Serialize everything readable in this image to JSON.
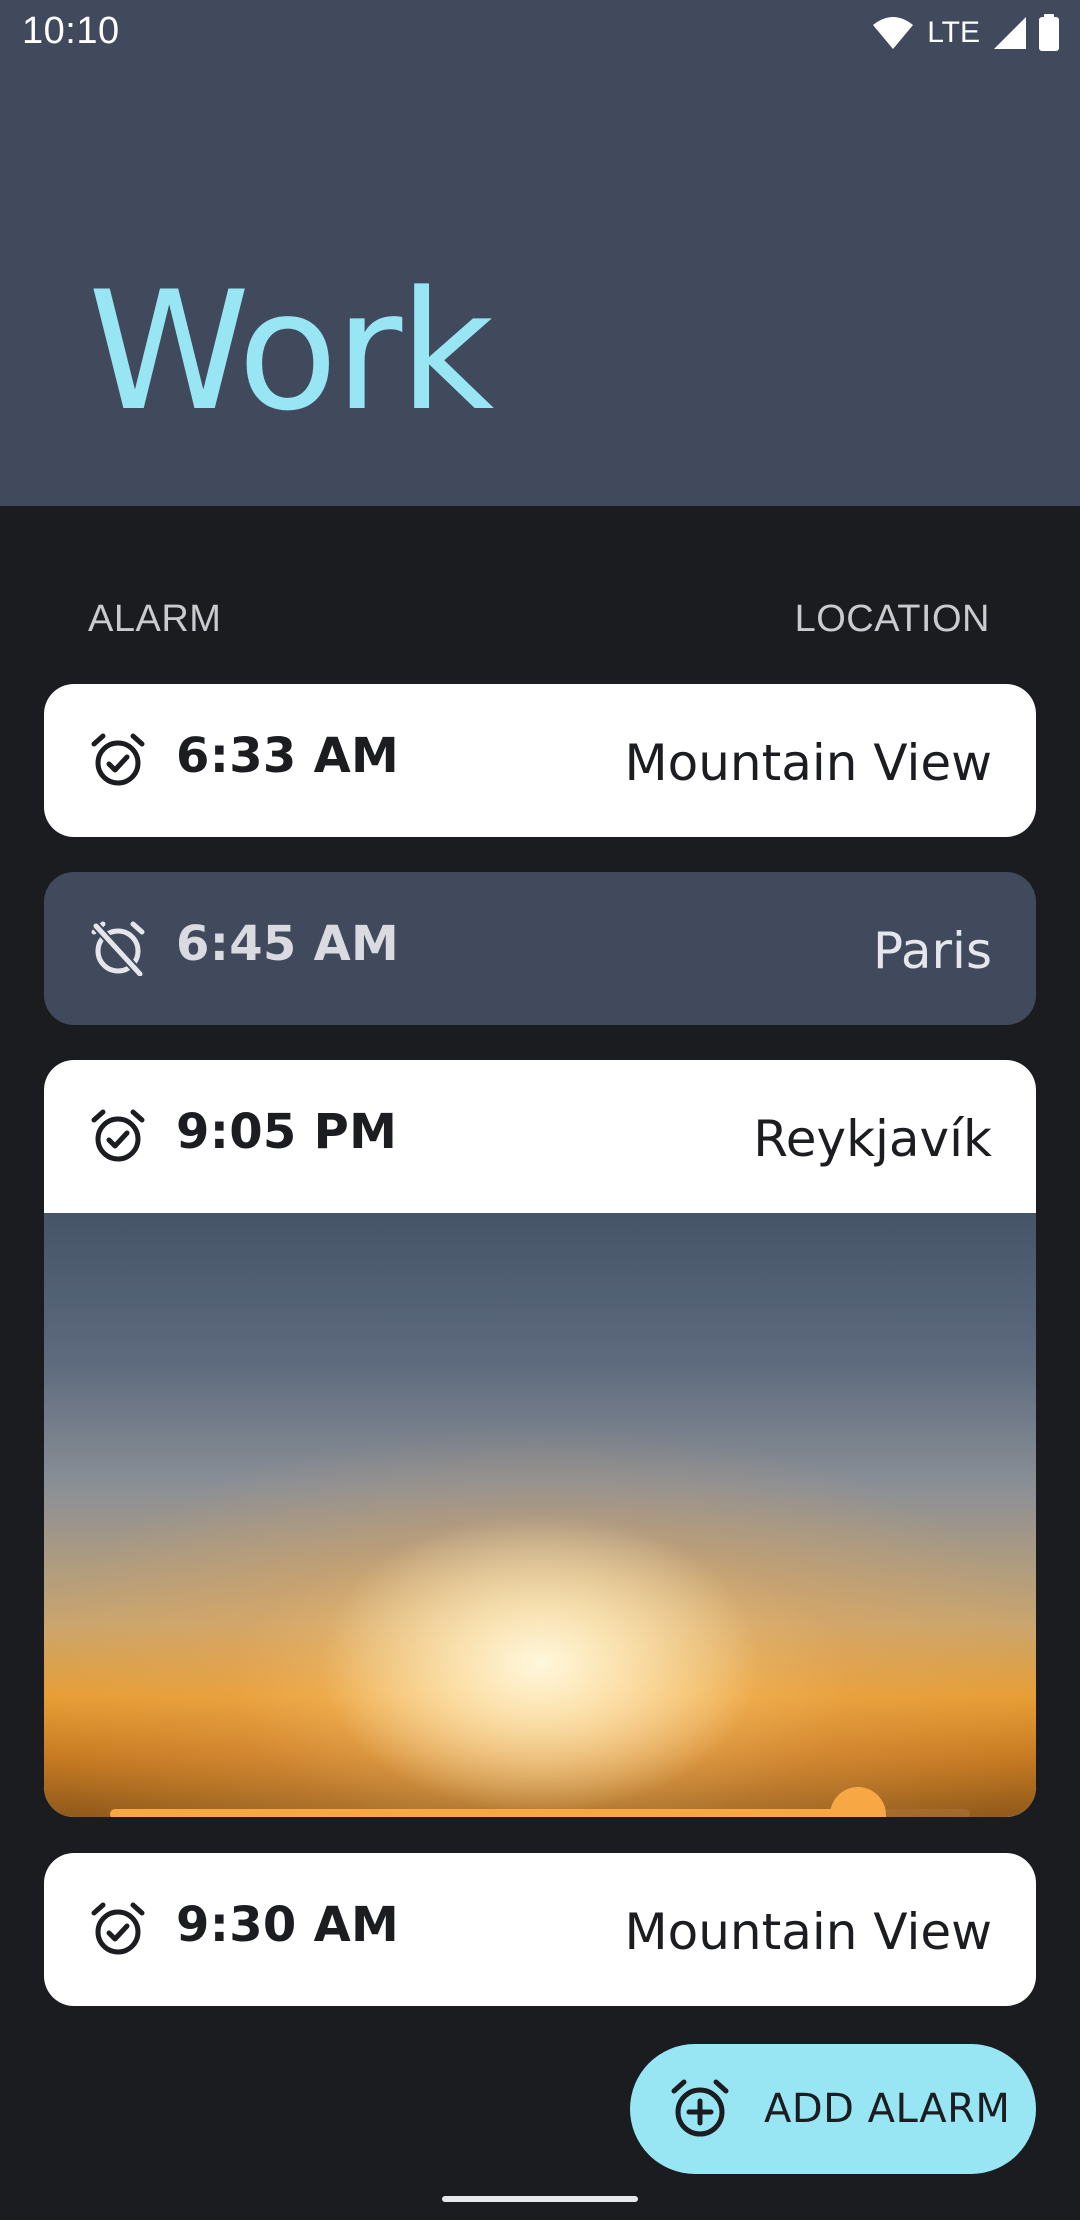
{
  "status_bar": {
    "time": "10:10",
    "network": "LTE"
  },
  "header": {
    "title": "Work"
  },
  "columns": {
    "alarm": "ALARM",
    "location": "LOCATION"
  },
  "alarms": [
    {
      "time": "6:33 AM",
      "location": "Mountain View",
      "enabled": true,
      "icon": "alarm-on-icon"
    },
    {
      "time": "6:45 AM",
      "location": "Paris",
      "enabled": false,
      "icon": "alarm-off-icon"
    },
    {
      "time": "9:05 PM",
      "location": "Reykjavík",
      "enabled": true,
      "icon": "alarm-on-icon",
      "expanded": true,
      "slider_value": 0.87
    },
    {
      "time": "9:30 AM",
      "location": "Mountain View",
      "enabled": true,
      "icon": "alarm-on-icon"
    }
  ],
  "fab": {
    "label": "ADD ALARM",
    "icon": "alarm-add-icon"
  },
  "colors": {
    "header_bg": "#414a5d",
    "accent": "#98e6f3",
    "background": "#1b1c20",
    "slider": "#f7a845"
  }
}
